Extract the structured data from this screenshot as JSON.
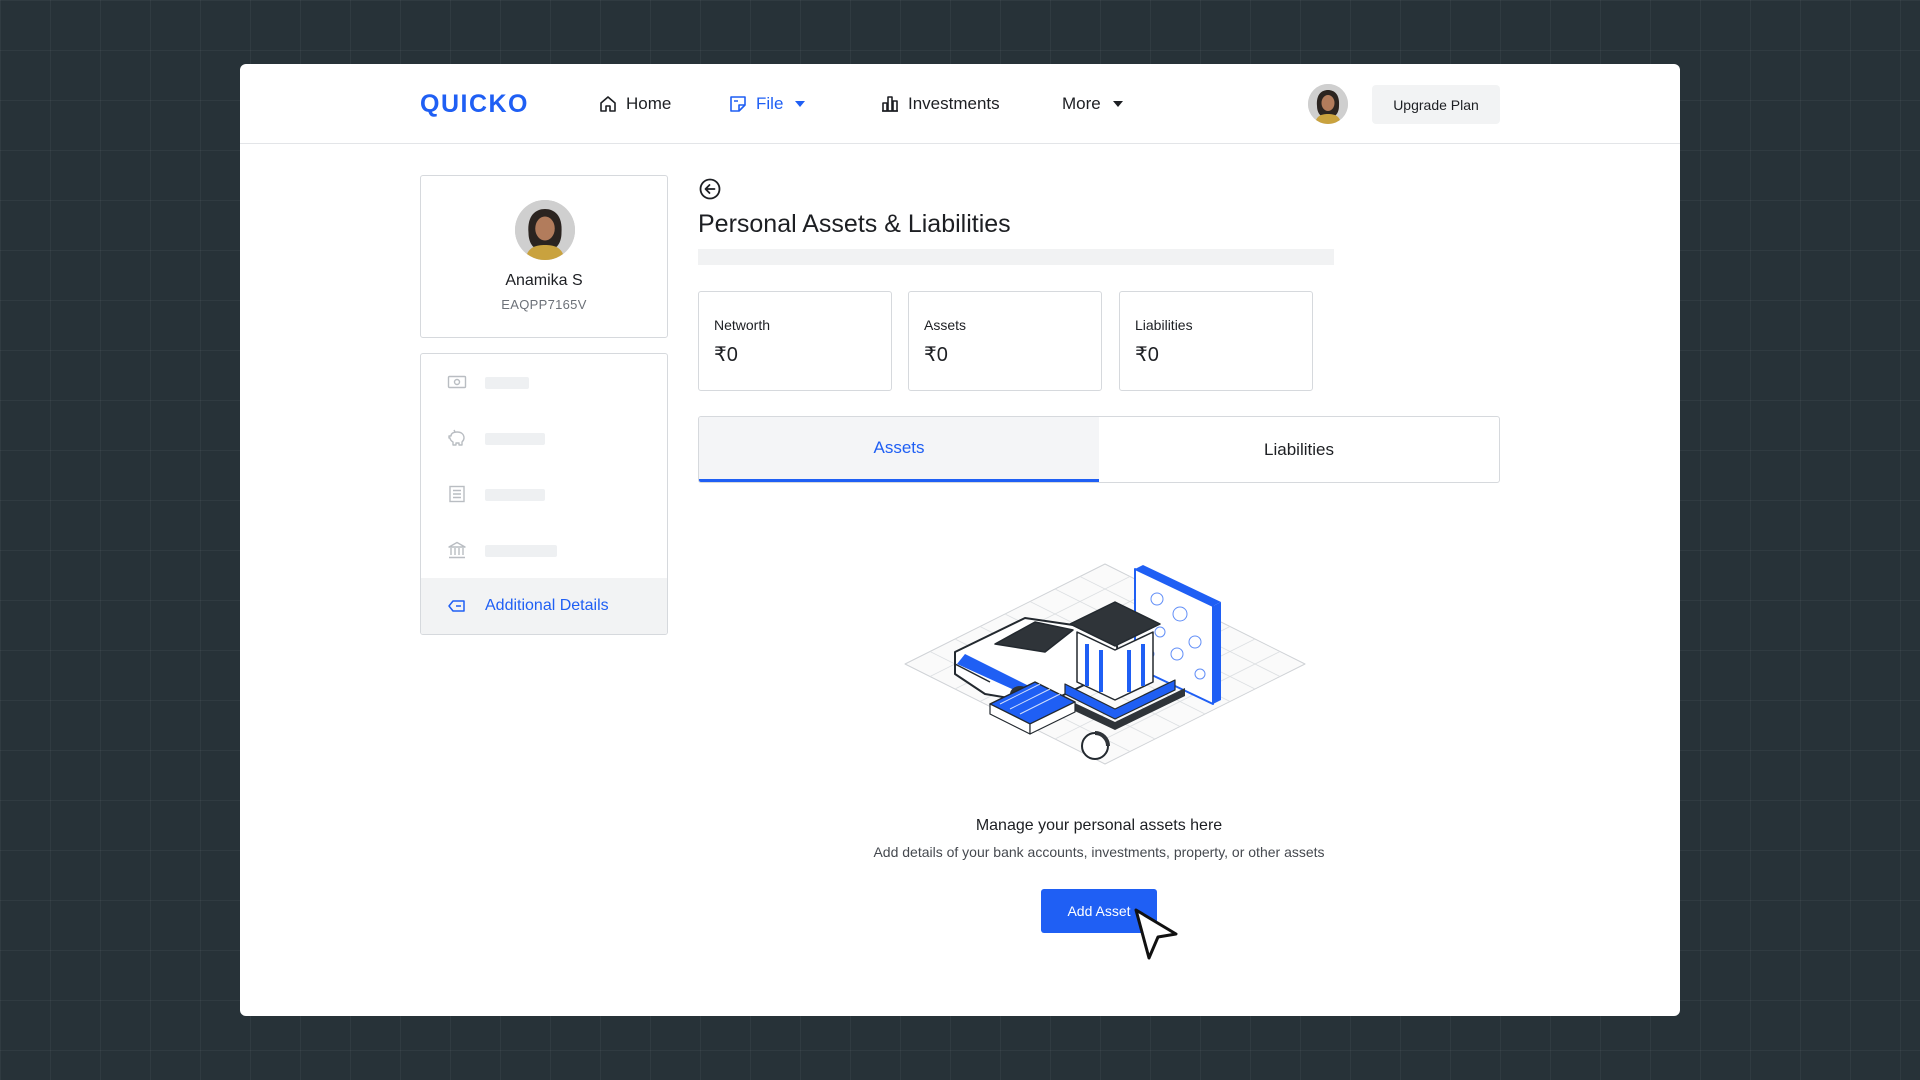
{
  "header": {
    "logo": "QUICKO",
    "nav": [
      {
        "label": "Home",
        "icon": "home-icon"
      },
      {
        "label": "File",
        "icon": "file-icon",
        "active": true
      },
      {
        "label": "Investments",
        "icon": "investments-icon"
      },
      {
        "label": "More"
      }
    ],
    "upgrade_label": "Upgrade Plan"
  },
  "profile": {
    "name": "Anamika S",
    "pan": "EAQPP7165V"
  },
  "sidebar": {
    "items": [
      {
        "icon": "cash-icon",
        "loading": true
      },
      {
        "icon": "piggy-bank-icon",
        "loading": true
      },
      {
        "icon": "document-list-icon",
        "loading": true
      },
      {
        "icon": "bank-icon",
        "loading": true
      },
      {
        "icon": "tag-icon",
        "label": "Additional Details",
        "active": true
      }
    ]
  },
  "main": {
    "title": "Personal Assets & Liabilities",
    "stats": [
      {
        "label": "Networth",
        "value": "₹0"
      },
      {
        "label": "Assets",
        "value": "₹0"
      },
      {
        "label": "Liabilities",
        "value": "₹0"
      }
    ],
    "tabs": [
      {
        "label": "Assets",
        "active": true
      },
      {
        "label": "Liabilities"
      }
    ],
    "empty_state": {
      "title": "Manage your personal assets here",
      "subtitle": "Add details of your bank accounts, investments, property, or other assets",
      "button_label": "Add Asset"
    }
  },
  "colors": {
    "accent": "#1f5ff4",
    "background": "#273238",
    "card_border": "#d6d9dd"
  }
}
